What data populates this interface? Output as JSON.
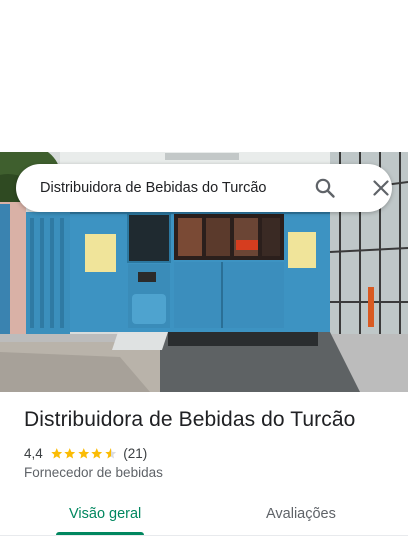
{
  "search": {
    "query": "Distribuidora de Bebidas do Turcão",
    "search_icon": "search-icon",
    "close_icon": "close-icon"
  },
  "place": {
    "photo": "storefront-photo",
    "title": "Distribuidora de Bebidas do Turcão",
    "rating": "4,4",
    "rating_stars": 4.4,
    "reviews": "(21)",
    "category": "Fornecedor de bebidas"
  },
  "tabs": [
    {
      "label": "Visão geral",
      "selected": true
    },
    {
      "label": "Avaliações",
      "selected": false
    }
  ],
  "colors": {
    "accent": "#01875f",
    "star": "#fbbc04",
    "text": "#202124",
    "secondary_text": "#5f6368"
  }
}
